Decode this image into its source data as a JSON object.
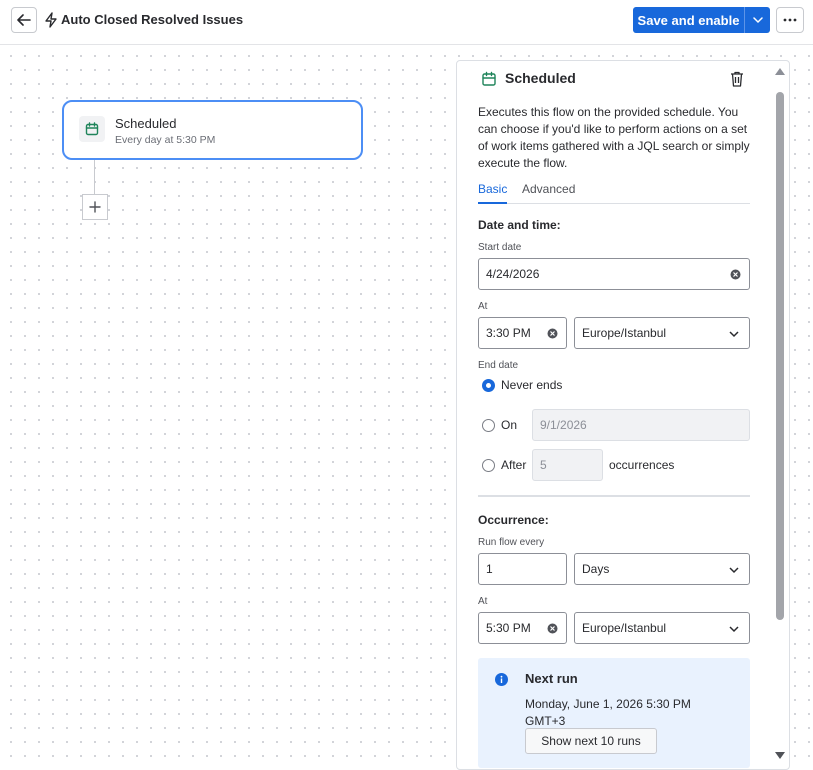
{
  "header": {
    "title": "Auto Closed Resolved Issues",
    "save_label": "Save and enable",
    "accent": "#1868db"
  },
  "canvas": {
    "trigger": {
      "title": "Scheduled",
      "subtitle": "Every day at 5:30 PM",
      "icon": "calendar-icon"
    },
    "add_step_icon": "plus-icon"
  },
  "panel": {
    "title": "Scheduled",
    "description": "Executes this flow on the provided schedule. You can choose if you'd like to perform actions on a set of work items gathered with a JQL search or simply execute the flow.",
    "tabs": [
      {
        "label": "Basic",
        "active": true
      },
      {
        "label": "Advanced",
        "active": false
      }
    ],
    "date_time": {
      "heading": "Date and time:",
      "start_date_label": "Start date",
      "start_date": "4/24/2026",
      "at_label": "At",
      "time": "3:30 PM",
      "timezone": "Europe/Istanbul"
    },
    "end_date": {
      "label": "End date",
      "options": {
        "never": "Never ends",
        "on": "On",
        "after": "After"
      },
      "selected": "never",
      "on_date": "9/1/2026",
      "after_count": "5",
      "occurrences_label": "occurrences"
    },
    "occurrence": {
      "heading": "Occurrence:",
      "run_every_label": "Run flow every",
      "run_every_value": "1",
      "unit": "Days",
      "at_label": "At",
      "time": "5:30 PM",
      "timezone": "Europe/Istanbul"
    },
    "next_run": {
      "title": "Next run",
      "text": "Monday, June 1, 2026 5:30 PM GMT+3",
      "button": "Show next 10 runs"
    }
  }
}
